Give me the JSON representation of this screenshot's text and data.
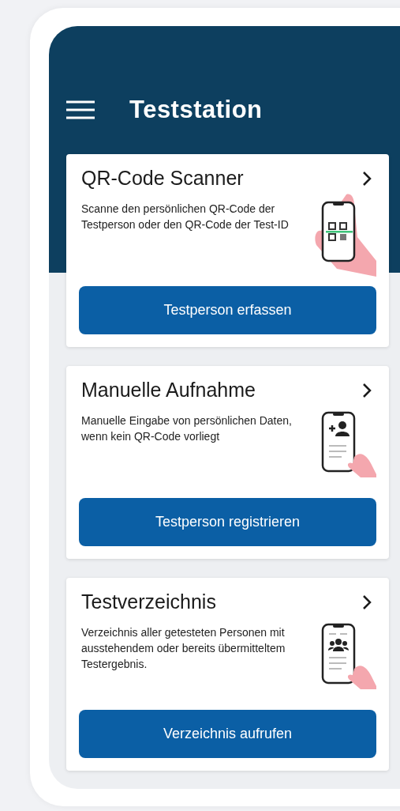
{
  "header": {
    "title": "Teststation"
  },
  "cards": [
    {
      "title": "QR-Code Scanner",
      "description": "Scanne den persönlichen QR-Code der Testperson oder den QR-Code der Test-ID",
      "kind": "qr",
      "button": "Testperson erfassen"
    },
    {
      "title": "Manuelle Aufnahme",
      "description": "Manuelle Eingabe von persönlichen Daten, wenn kein QR-Code vorliegt",
      "kind": "add-person",
      "button": "Testperson registrieren"
    },
    {
      "title": "Testverzeichnis",
      "description": "Verzeichnis aller getesteten Personen mit ausstehendem oder bereits übermitteltem Testergebnis.",
      "kind": "group",
      "button": "Verzeichnis aufrufen"
    }
  ]
}
